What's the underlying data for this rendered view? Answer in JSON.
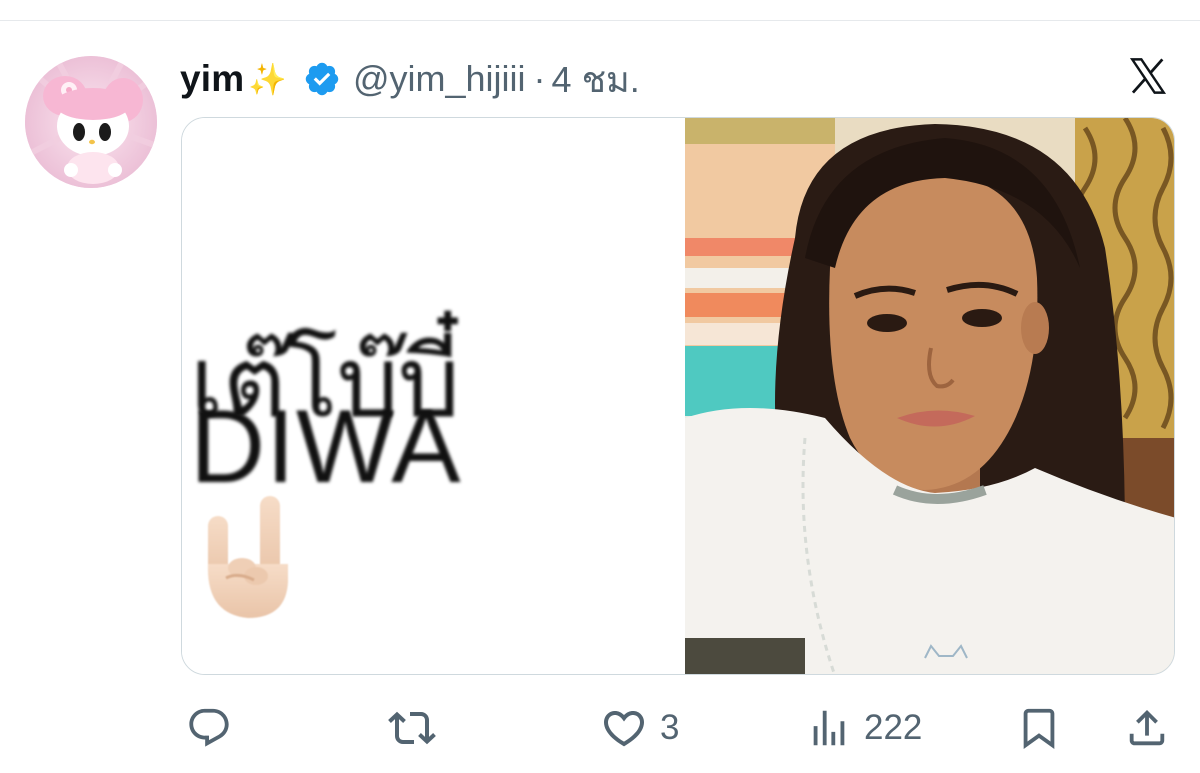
{
  "tweet": {
    "display_name": "yim",
    "name_emoji": "✨",
    "handle": "@yim_hijiii",
    "separator": "·",
    "timestamp": "4 ชม.",
    "media_text_thai": "เต๊โบ๊บี๋",
    "media_text_latin": "DIWA"
  },
  "actions": {
    "reply_count": "",
    "retweet_count": "",
    "like_count": "3",
    "view_count": "222"
  },
  "icons": {
    "verified": "verified-badge-icon",
    "logo": "x-logo-icon",
    "reply": "reply-icon",
    "retweet": "retweet-icon",
    "like": "heart-icon",
    "views": "views-icon",
    "bookmark": "bookmark-icon",
    "share": "share-icon"
  },
  "colors": {
    "verified_blue": "#1d9bf0",
    "secondary_text": "#536471",
    "primary_text": "#0f1419",
    "border": "#cfd9de"
  }
}
